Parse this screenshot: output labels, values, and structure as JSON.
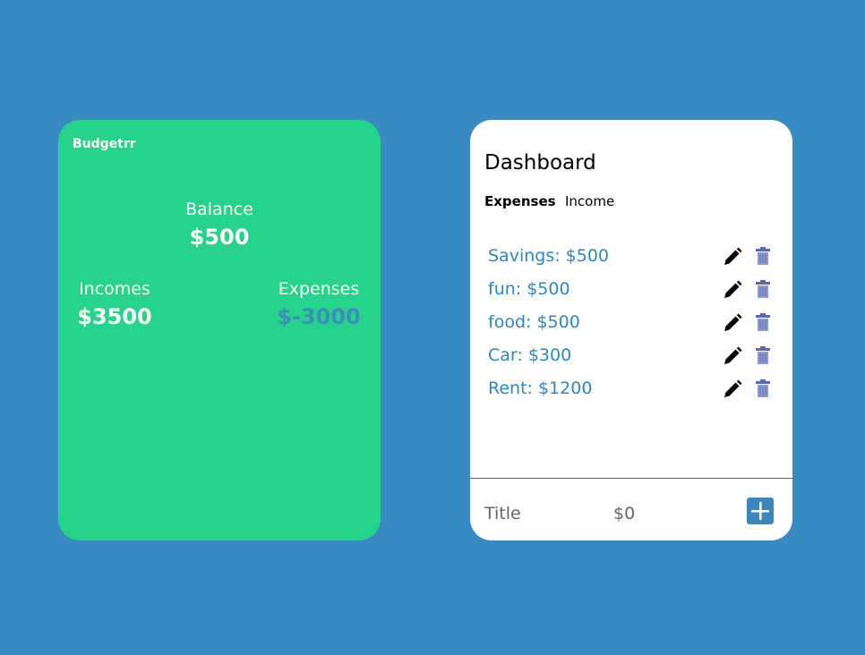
{
  "app": {
    "name": "Budgetrr"
  },
  "summary": {
    "balance_label": "Balance",
    "balance_value": "$500",
    "incomes_label": "Incomes",
    "incomes_value": "$3500",
    "expenses_label": "Expenses",
    "expenses_value": "$-3000"
  },
  "dashboard": {
    "title": "Dashboard",
    "tabs": [
      {
        "label": "Expenses",
        "active": true
      },
      {
        "label": "Income",
        "active": false
      }
    ],
    "items": [
      {
        "label": "Savings: $500"
      },
      {
        "label": "fun: $500"
      },
      {
        "label": "food: $500"
      },
      {
        "label": "Car: $300"
      },
      {
        "label": "Rent: $1200"
      }
    ],
    "form": {
      "title_placeholder": "Title",
      "amount_placeholder": "$0"
    }
  },
  "colors": {
    "background": "#388bc2",
    "summary_card": "#26d38a",
    "accent": "#2d87c0",
    "trash": "#7e8ec9"
  }
}
